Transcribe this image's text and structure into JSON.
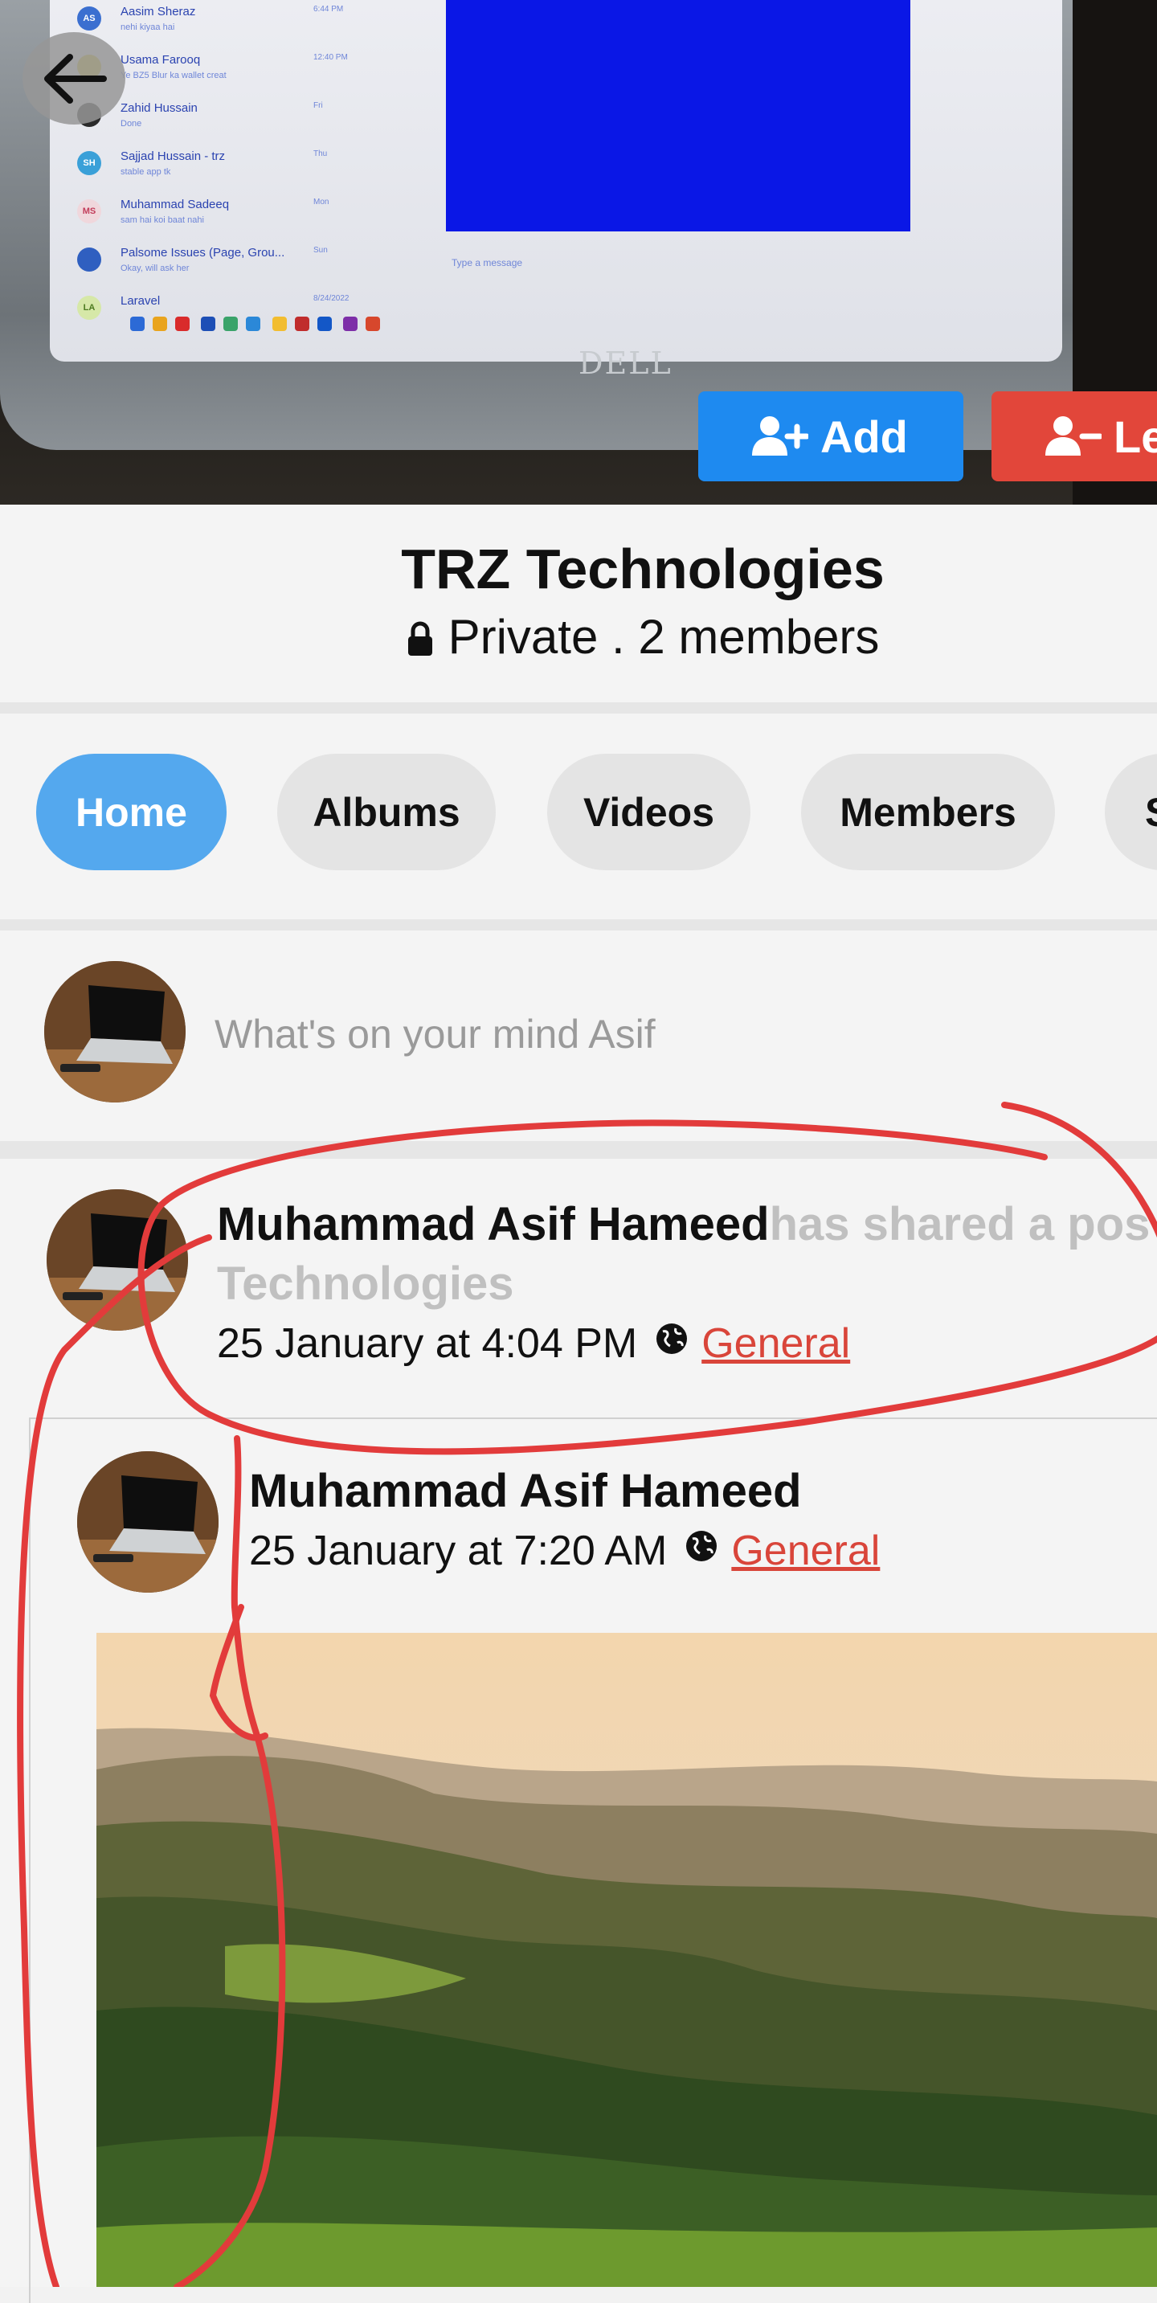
{
  "cover": {
    "chat_items": [
      {
        "initials": "AS",
        "name": "Aasim Sheraz",
        "snippet": "nehi kiyaa hai",
        "time": "6:44 PM"
      },
      {
        "initials": "",
        "name": "Usama Farooq",
        "snippet": "Ye BZ5 Blur ka wallet creat",
        "time": "12:40 PM"
      },
      {
        "initials": "",
        "name": "Zahid Hussain",
        "snippet": "Done",
        "time": "Fri"
      },
      {
        "initials": "SH",
        "name": "Sajjad Hussain - trz",
        "snippet": "stable app tk",
        "time": "Thu"
      },
      {
        "initials": "MS",
        "name": "Muhammad Sadeeq",
        "snippet": "sam hai koi baat nahi",
        "time": "Mon"
      },
      {
        "initials": "",
        "name": "Palsome Issues (Page, Grou...",
        "snippet": "Okay, will ask her",
        "time": "Sun"
      },
      {
        "initials": "LA",
        "name": "Laravel",
        "snippet": "",
        "time": "8/24/2022"
      }
    ],
    "message_placeholder": "Type a message",
    "laptop_logo": "DELL",
    "add_label": "Add",
    "leave_label": "Lea"
  },
  "group": {
    "title": "TRZ Technologies",
    "meta": "Private . 2 members"
  },
  "tabs": [
    {
      "label": "Home",
      "active": true
    },
    {
      "label": "Albums",
      "active": false
    },
    {
      "label": "Videos",
      "active": false
    },
    {
      "label": "Members",
      "active": false
    },
    {
      "label": "S",
      "active": false
    }
  ],
  "composer": {
    "placeholder": "What's on your mind Asif"
  },
  "post": {
    "author": "Muhammad Asif Hameed",
    "action_text": "has shared a pos",
    "action_text_line2": "Technologies",
    "timestamp": "25 January at 4:04 PM",
    "audience": "General",
    "shared": {
      "author": "Muhammad Asif Hameed",
      "timestamp": "25 January at 7:20 AM",
      "audience": "General"
    }
  },
  "colors": {
    "accent_blue": "#1e8af0",
    "active_tab": "#54a8ee",
    "leave_red": "#e2463a",
    "link_red": "#d9453a",
    "annotation_red": "#e23b3b"
  }
}
